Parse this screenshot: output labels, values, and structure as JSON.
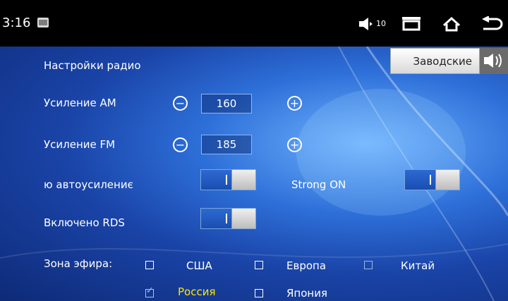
{
  "status_bar": {
    "time": "3:16",
    "volume_level": "10"
  },
  "header": {
    "title": "Настройки радио",
    "factory_button": "Заводские"
  },
  "rows": {
    "am_gain": {
      "label": "Усиление AM",
      "value": "160",
      "minus": "−",
      "plus": "+"
    },
    "fm_gain": {
      "label": "Усиление FM",
      "value": "185",
      "minus": "−",
      "plus": "+"
    },
    "auto_gain": {
      "label": "ю автоусилениє",
      "on": true
    },
    "strong": {
      "label": "Strong ON",
      "on": true
    },
    "rds": {
      "label": "Включено RDS",
      "on": true
    }
  },
  "zone": {
    "label": "Зона эфира:",
    "options": [
      {
        "label": "США",
        "checked": false
      },
      {
        "label": "Европа",
        "checked": false
      },
      {
        "label": "Китай",
        "checked": false
      },
      {
        "label": "Россия",
        "checked": true
      },
      {
        "label": "Япония",
        "checked": false
      }
    ]
  },
  "colors": {
    "status_bg": "#000000",
    "selected_text": "#ffe600",
    "toggle_on": "#2d6ad2"
  }
}
